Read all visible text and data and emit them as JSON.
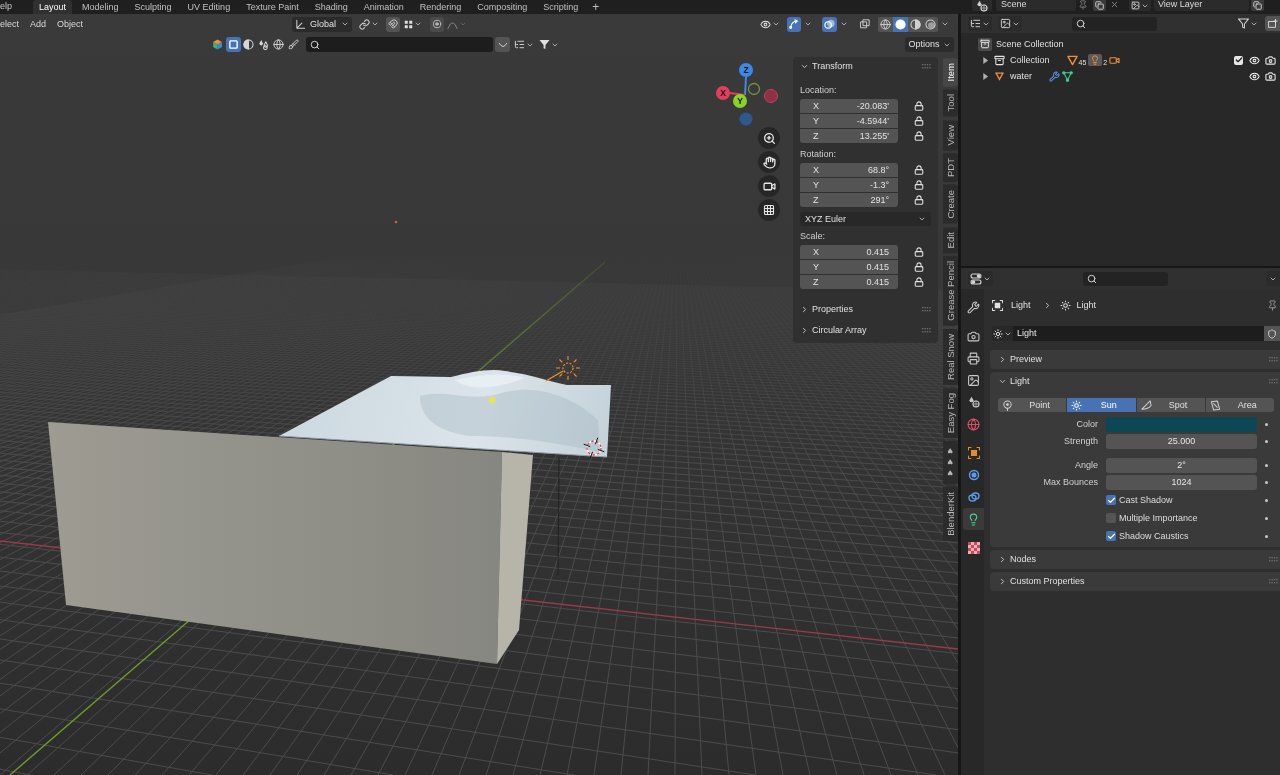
{
  "top_bar": {
    "help_menu": "elp",
    "workspaces": [
      {
        "label": "Layout",
        "selected": true
      },
      {
        "label": "Modeling",
        "selected": false
      },
      {
        "label": "Sculpting",
        "selected": false
      },
      {
        "label": "UV Editing",
        "selected": false
      },
      {
        "label": "Texture Paint",
        "selected": false
      },
      {
        "label": "Shading",
        "selected": false
      },
      {
        "label": "Animation",
        "selected": false
      },
      {
        "label": "Rendering",
        "selected": false
      },
      {
        "label": "Compositing",
        "selected": false
      },
      {
        "label": "Scripting",
        "selected": false
      }
    ],
    "add_workspace": "+",
    "scene": "Scene",
    "view_layer": "View Layer"
  },
  "viewport": {
    "menus": [
      "elect",
      "Add",
      "Object"
    ],
    "orientation": "Global",
    "gizmos": {
      "on": true
    },
    "overlays": {
      "on": true
    },
    "xray": {
      "on": false
    },
    "shading_modes": [
      {
        "kind": "wireframe",
        "selected": false
      },
      {
        "kind": "solid",
        "selected": true
      },
      {
        "kind": "material",
        "selected": false
      },
      {
        "kind": "rendered",
        "selected": false
      }
    ],
    "type_filters": [
      {
        "kind": "object",
        "selected": true
      },
      {
        "kind": "data",
        "selected": false
      },
      {
        "kind": "physics",
        "selected": false
      },
      {
        "kind": "world",
        "selected": false
      },
      {
        "kind": "paint",
        "selected": false
      }
    ],
    "options": "Options",
    "navigation_gizmo": {
      "axes": [
        "Z",
        "X",
        "Y"
      ]
    }
  },
  "sidebar": {
    "tabs": [
      {
        "label": "Item",
        "selected": true
      },
      {
        "label": "Tool",
        "selected": false
      },
      {
        "label": "View",
        "selected": false
      },
      {
        "label": "PDT",
        "selected": false
      },
      {
        "label": "Create",
        "selected": false
      },
      {
        "label": "Edit",
        "selected": false
      },
      {
        "label": "Grease Pencil",
        "selected": false
      },
      {
        "label": "Real Snow",
        "selected": false
      },
      {
        "label": "Easy Fog",
        "selected": false
      },
      {
        "label": "♥♥♥",
        "selected": false
      },
      {
        "label": "BlenderKit",
        "selected": false
      }
    ],
    "panels": [
      {
        "title": "Transform",
        "expanded": true,
        "groups": [
          {
            "label": "Location:",
            "fields": [
              {
                "axis": "X",
                "value": "-20.083'"
              },
              {
                "axis": "Y",
                "value": "-4.5944'"
              },
              {
                "axis": "Z",
                "value": "13.255'"
              }
            ]
          },
          {
            "label": "Rotation:",
            "fields": [
              {
                "axis": "X",
                "value": "68.8°"
              },
              {
                "axis": "Y",
                "value": "-1.3°"
              },
              {
                "axis": "Z",
                "value": "291°"
              }
            ],
            "mode": "XYZ Euler"
          },
          {
            "label": "Scale:",
            "fields": [
              {
                "axis": "X",
                "value": "0.415"
              },
              {
                "axis": "Y",
                "value": "0.415"
              },
              {
                "axis": "Z",
                "value": "0.415"
              }
            ]
          }
        ]
      },
      {
        "title": "Properties",
        "expanded": false
      },
      {
        "title": "Circular Array",
        "expanded": false
      }
    ]
  },
  "outliner": {
    "tree": [
      {
        "name": "Scene Collection",
        "children": [
          {
            "name": "Collection",
            "kind": "collection",
            "expanded": false,
            "checked": true,
            "badges": [
              {
                "kind": "mesh",
                "count": "45"
              },
              {
                "kind": "light",
                "count": "2"
              },
              {
                "kind": "camera"
              }
            ]
          },
          {
            "name": "water",
            "kind": "mesh",
            "expanded": false,
            "badges": [
              {
                "kind": "modifier"
              },
              {
                "kind": "vertex_groups"
              }
            ]
          }
        ]
      }
    ]
  },
  "properties": {
    "tab_groups": [
      {
        "tabs": [
          {
            "kind": "tool",
            "selected": false
          }
        ]
      },
      {
        "tabs": [
          {
            "kind": "render",
            "selected": false
          },
          {
            "kind": "output",
            "selected": false
          },
          {
            "kind": "view_layer",
            "selected": false
          },
          {
            "kind": "scene",
            "selected": false
          },
          {
            "kind": "world",
            "selected": false
          }
        ]
      },
      {
        "tabs": [
          {
            "kind": "object",
            "selected": false
          },
          {
            "kind": "physics",
            "selected": false
          },
          {
            "kind": "constraints",
            "selected": false
          },
          {
            "kind": "light",
            "selected": true
          }
        ]
      },
      {
        "tabs": [
          {
            "kind": "texture",
            "selected": false
          }
        ]
      }
    ],
    "breadcrumb": [
      {
        "kind": "object",
        "label": "Light"
      },
      {
        "kind": "light",
        "label": "Light"
      }
    ],
    "datablock": "Light",
    "panels": [
      {
        "title": "Preview",
        "expanded": false
      },
      {
        "title": "Light",
        "expanded": true,
        "types": [
          {
            "label": "Point",
            "selected": false
          },
          {
            "label": "Sun",
            "selected": true
          },
          {
            "label": "Spot",
            "selected": false
          },
          {
            "label": "Area",
            "selected": false
          }
        ],
        "sections": [
          {
            "rows": [
              {
                "kind": "color",
                "label": "Color",
                "color": "#0c4753"
              },
              {
                "kind": "number",
                "label": "Strength",
                "value": "25.000"
              }
            ]
          },
          {
            "rows": [
              {
                "kind": "number",
                "label": "Angle",
                "value": "2°"
              },
              {
                "kind": "number",
                "label": "Max Bounces",
                "value": "1024"
              },
              {
                "kind": "checkbox",
                "label": "Cast Shadow",
                "checked": true
              },
              {
                "kind": "checkbox",
                "label": "Multiple Importance",
                "checked": false
              },
              {
                "kind": "checkbox",
                "label": "Shadow Caustics",
                "checked": true
              }
            ]
          }
        ]
      },
      {
        "title": "Nodes",
        "expanded": false
      },
      {
        "title": "Custom Properties",
        "expanded": false
      }
    ]
  }
}
